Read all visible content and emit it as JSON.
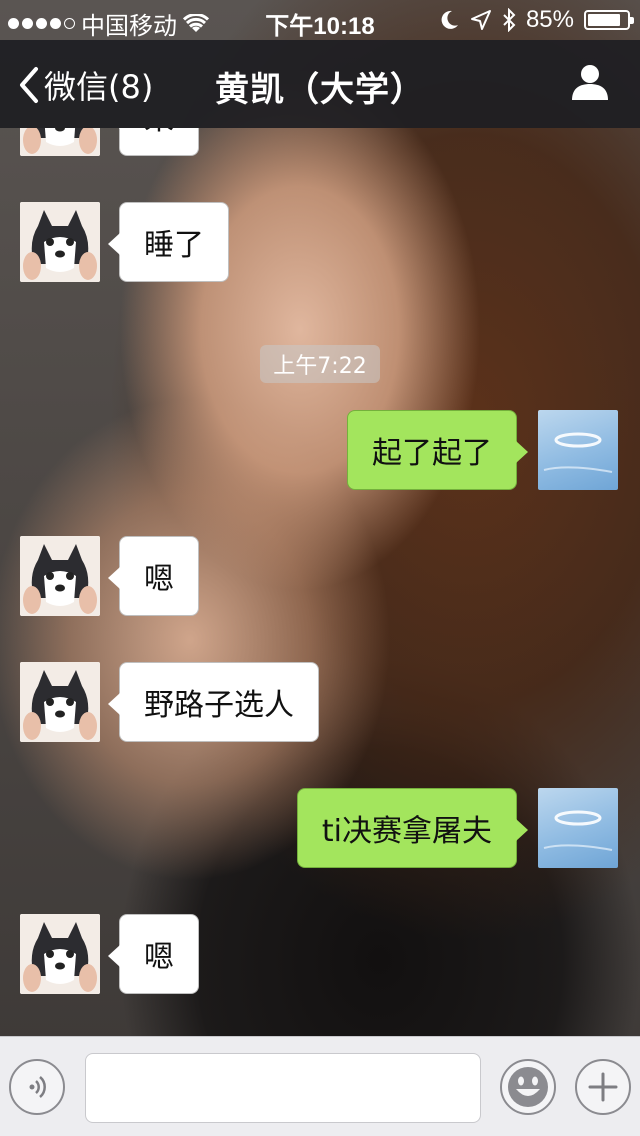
{
  "status_bar": {
    "carrier": "中国移动",
    "time": "下午10:18",
    "battery_percent": "85%",
    "battery_level": 0.85
  },
  "nav": {
    "back_label": "微信(8)",
    "title": "黄凯（大学）"
  },
  "messages": [
    {
      "side": "in",
      "text": "来"
    },
    {
      "side": "in",
      "text": "睡了"
    },
    {
      "side": "out",
      "text": "起了起了"
    },
    {
      "side": "in",
      "text": "嗯"
    },
    {
      "side": "in",
      "text": "野路子选人"
    },
    {
      "side": "out",
      "text": "ti决赛拿屠夫"
    },
    {
      "side": "in",
      "text": "嗯"
    }
  ],
  "timestamp": "上午7:22",
  "input": {
    "placeholder": ""
  },
  "colors": {
    "outgoing_bubble": "#a3e55d",
    "incoming_bubble": "#ffffff",
    "nav_bar": "#1e1e22"
  }
}
